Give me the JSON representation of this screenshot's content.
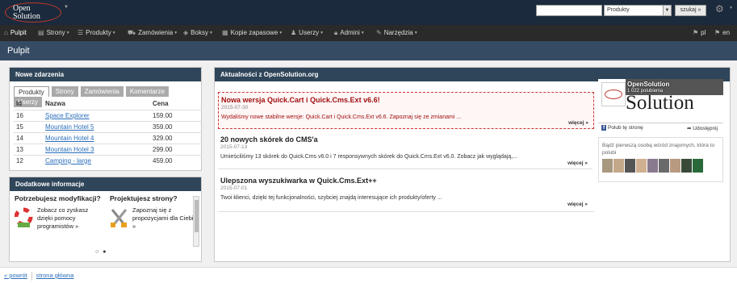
{
  "logo": {
    "line1": "Open",
    "line2": "Solution"
  },
  "header": {
    "search_value": "",
    "search_select": "Produkty",
    "search_button": "szukaj »"
  },
  "nav": {
    "items": [
      {
        "label": "Pulpit",
        "icon": "home-icon"
      },
      {
        "label": "Strony",
        "icon": "pages-icon"
      },
      {
        "label": "Produkty",
        "icon": "list-icon"
      },
      {
        "label": "Zamówienia",
        "icon": "cart-icon"
      },
      {
        "label": "Boksy",
        "icon": "box-icon"
      },
      {
        "label": "Kopie zapasowe",
        "icon": "archive-icon"
      },
      {
        "label": "Userzy",
        "icon": "user-icon"
      },
      {
        "label": "Admini",
        "icon": "lock-icon"
      },
      {
        "label": "Narzędzia",
        "icon": "tools-icon"
      }
    ],
    "lang_pl": "pl",
    "lang_en": "en"
  },
  "page_title": "Pulpit",
  "events": {
    "title": "Nowe zdarzenia",
    "tabs": [
      "Produkty",
      "Strony",
      "Zamówienia",
      "Komentarze",
      "Userzy"
    ],
    "active_tab": "Produkty",
    "columns": [
      "Id",
      "Nazwa",
      "Cena"
    ],
    "rows": [
      {
        "id": "16",
        "name": "Space Explorer",
        "price": "159.00"
      },
      {
        "id": "15",
        "name": "Mountain Hotel 5",
        "price": "359.00"
      },
      {
        "id": "14",
        "name": "Mountain Hotel 4",
        "price": "329.00"
      },
      {
        "id": "13",
        "name": "Mountain Hotel 3",
        "price": "299.00"
      },
      {
        "id": "12",
        "name": "Camping - large",
        "price": "459.00"
      }
    ]
  },
  "extra": {
    "title": "Dodatkowe informacje",
    "col1": {
      "title": "Potrzebujesz modyfikacji?",
      "text": "Zobacz co zyskasz dzięki pomocy programistów »"
    },
    "col2": {
      "title": "Projektujesz strony?",
      "text": "Zapoznaj się z propozycjami dla Ciebie »"
    }
  },
  "news": {
    "title": "Aktualności z OpenSolution.org",
    "more_label": "więcej »",
    "items": [
      {
        "title": "Nowa wersja Quick.Cart i Quick.Cms.Ext v6.6!",
        "date": "2015-07-30",
        "text": "Wydaliśmy nowe stabilne wersje: Quick.Cart i Quick.Cms.Ext v6.6. Zapoznaj się ze zmianami ..."
      },
      {
        "title": "20 nowych skórek do CMS'a",
        "date": "2015-07-13",
        "text": "Umieściliśmy 13 skórek do Quick.Cms v6.0 i 7 responsywnych skórek do Quick.Cms.Ext v6.0. Zobacz jak wyglądają,..."
      },
      {
        "title": "Ulepszona wyszukiwarka w Quick.Cms.Ext++",
        "date": "2015-07-01",
        "text": "Twoi klienci, dzięki tej funkcjonalności, szybciej znajdą interesujące ich produkty/oferty ..."
      }
    ]
  },
  "facebook": {
    "page_name": "OpenSolution",
    "likes": "1 022 polubienia",
    "brand": "Solution",
    "like_label": "Polub tę stronę",
    "share_label": "Udostępnij",
    "friends_text": "Bądź pierwszą osobą wśród znajomych, która to polubi"
  },
  "footer": {
    "back": "« powrót",
    "home": "strona główna"
  },
  "colors": {
    "header": "#1b2a3c",
    "titlebar": "#354b63",
    "panel_head": "#2f4559",
    "news_highlight": "#a01010",
    "link": "#2a6ebb"
  }
}
